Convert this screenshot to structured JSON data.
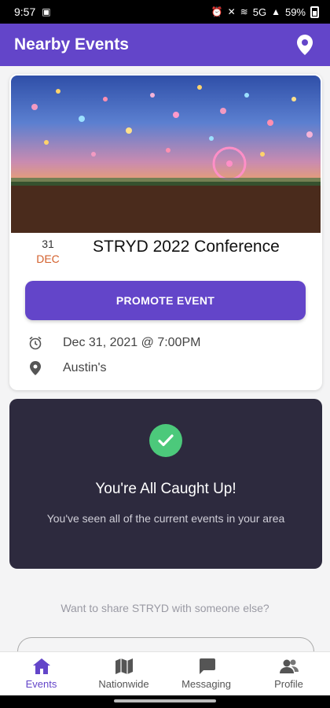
{
  "status_bar": {
    "time": "9:57",
    "network": "5G",
    "battery": "59%"
  },
  "app_bar": {
    "title": "Nearby Events"
  },
  "event": {
    "date_day": "31",
    "date_month": "DEC",
    "title": "STRYD 2022 Conference",
    "promote_label": "PROMOTE EVENT",
    "datetime": "Dec 31, 2021 @ 7:00PM",
    "venue": "Austin's"
  },
  "caught_up": {
    "title": "You're All Caught Up!",
    "subtitle": "You've seen all of the current events in your area"
  },
  "share": {
    "prompt": "Want to share STRYD with someone else?"
  },
  "nav": {
    "items": [
      {
        "label": "Events",
        "icon": "home-icon",
        "active": true
      },
      {
        "label": "Nationwide",
        "icon": "map-icon",
        "active": false
      },
      {
        "label": "Messaging",
        "icon": "chat-icon",
        "active": false
      },
      {
        "label": "Profile",
        "icon": "people-icon",
        "active": false
      }
    ]
  },
  "colors": {
    "primary": "#6345c9",
    "dark_card": "#2d2a3e",
    "success": "#4cc97b",
    "month_accent": "#d35f2b"
  }
}
